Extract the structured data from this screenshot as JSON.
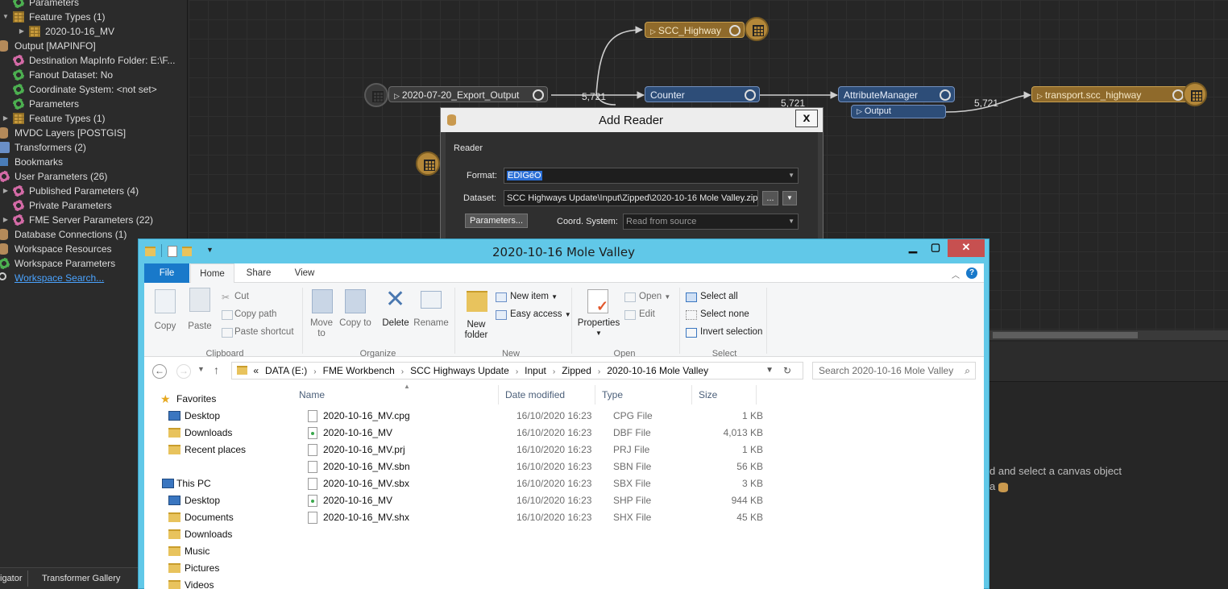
{
  "navigator": {
    "rows": [
      {
        "label": "Parameters",
        "icon": "gear-icon",
        "indent": 1
      },
      {
        "label": "Feature Types (1)",
        "icon": "table-icon",
        "indent": 1,
        "expanded": true
      },
      {
        "label": "2020-10-16_MV",
        "icon": "table-icon",
        "indent": 2
      },
      {
        "label": "Output [MAPINFO]",
        "icon": "database-icon",
        "indent": 0
      },
      {
        "label": "Destination MapInfo Folder: E:\\F...",
        "icon": "parameter-icon",
        "indent": 1
      },
      {
        "label": "Fanout Dataset: No",
        "icon": "gear-icon",
        "indent": 1
      },
      {
        "label": "Coordinate System: <not set>",
        "icon": "gear-icon",
        "indent": 1
      },
      {
        "label": "Parameters",
        "icon": "gear-icon",
        "indent": 1
      },
      {
        "label": "Feature Types (1)",
        "icon": "table-icon",
        "indent": 1
      },
      {
        "label": "MVDC Layers [POSTGIS]",
        "icon": "database-icon",
        "indent": 0
      },
      {
        "label": "Transformers (2)",
        "icon": "transformer-icon",
        "indent": 0
      },
      {
        "label": "Bookmarks",
        "icon": "bookmark-icon",
        "indent": 0
      },
      {
        "label": "User Parameters (26)",
        "icon": "parameter-icon",
        "indent": 0
      },
      {
        "label": "Published Parameters (4)",
        "icon": "parameter-icon",
        "indent": 1
      },
      {
        "label": "Private Parameters",
        "icon": "parameter-icon",
        "indent": 1
      },
      {
        "label": "FME Server Parameters (22)",
        "icon": "parameter-icon",
        "indent": 1
      },
      {
        "label": "Database Connections (1)",
        "icon": "database-icon",
        "indent": 0
      },
      {
        "label": "Workspace Resources",
        "icon": "database-icon",
        "indent": 0
      },
      {
        "label": "Workspace Parameters",
        "icon": "gear-icon",
        "indent": 0
      },
      {
        "label": "Workspace Search...",
        "icon": "search-icon",
        "indent": 0,
        "link": true
      }
    ],
    "tabs": [
      "igator",
      "Transformer Gallery"
    ]
  },
  "canvas": {
    "nodes": {
      "scc_highway": "SCC_Highway",
      "reader": "2020-07-20_Export_Output",
      "counter": "Counter",
      "attribute_manager": "AttributeManager",
      "output_port": "Output",
      "writer": "transport.scc_highway"
    },
    "counts": [
      "5,721",
      "5,721",
      "5,721"
    ]
  },
  "right_panel": {
    "hint_line1": "d and select a canvas object",
    "hint_line2": "a"
  },
  "add_reader": {
    "title": "Add Reader",
    "group_label": "Reader",
    "format_label": "Format:",
    "format_value": "EDIGéO",
    "dataset_label": "Dataset:",
    "dataset_value": "SCC Highways Update\\Input\\Zipped\\2020-10-16 Mole Valley.zip\"",
    "browse_label": "...",
    "parameters_label": "Parameters...",
    "coord_label": "Coord. System:",
    "coord_value": "Read from source",
    "close_label": "x"
  },
  "explorer": {
    "title": "2020-10-16 Mole Valley",
    "ribbon_tabs": [
      "File",
      "Home",
      "Share",
      "View"
    ],
    "ribbon": {
      "clipboard": {
        "group": "Clipboard",
        "copy": "Copy",
        "paste": "Paste",
        "cut": "Cut",
        "copy_path": "Copy path",
        "paste_shortcut": "Paste shortcut"
      },
      "organize": {
        "group": "Organize",
        "move_to": "Move to",
        "copy_to": "Copy to",
        "delete": "Delete",
        "rename": "Rename"
      },
      "new": {
        "group": "New",
        "new_folder": "New folder",
        "new_item": "New item",
        "easy_access": "Easy access"
      },
      "open": {
        "group": "Open",
        "properties": "Properties",
        "open": "Open",
        "edit": "Edit"
      },
      "select": {
        "group": "Select",
        "select_all": "Select all",
        "select_none": "Select none",
        "invert_selection": "Invert selection"
      }
    },
    "address": [
      "«",
      "DATA (E:)",
      "FME Workbench",
      "SCC Highways Update",
      "Input",
      "Zipped",
      "2020-10-16 Mole Valley"
    ],
    "search_placeholder": "Search 2020-10-16 Mole Valley",
    "tree": {
      "favorites": "Favorites",
      "fav_items": [
        "Desktop",
        "Downloads",
        "Recent places"
      ],
      "this_pc": "This PC",
      "pc_items": [
        "Desktop",
        "Documents",
        "Downloads",
        "Music",
        "Pictures",
        "Videos"
      ]
    },
    "columns": [
      "Name",
      "Date modified",
      "Type",
      "Size"
    ],
    "files": [
      {
        "name": "2020-10-16_MV.cpg",
        "date": "16/10/2020 16:23",
        "type": "CPG File",
        "size": "1 KB",
        "icon": "file-icon"
      },
      {
        "name": "2020-10-16_MV",
        "date": "16/10/2020 16:23",
        "type": "DBF File",
        "size": "4,013 KB",
        "icon": "dbf-file-icon"
      },
      {
        "name": "2020-10-16_MV.prj",
        "date": "16/10/2020 16:23",
        "type": "PRJ File",
        "size": "1 KB",
        "icon": "file-icon"
      },
      {
        "name": "2020-10-16_MV.sbn",
        "date": "16/10/2020 16:23",
        "type": "SBN File",
        "size": "56 KB",
        "icon": "file-icon"
      },
      {
        "name": "2020-10-16_MV.sbx",
        "date": "16/10/2020 16:23",
        "type": "SBX File",
        "size": "3 KB",
        "icon": "file-icon"
      },
      {
        "name": "2020-10-16_MV",
        "date": "16/10/2020 16:23",
        "type": "SHP File",
        "size": "944 KB",
        "icon": "shp-file-icon"
      },
      {
        "name": "2020-10-16_MV.shx",
        "date": "16/10/2020 16:23",
        "type": "SHX File",
        "size": "45 KB",
        "icon": "file-icon"
      }
    ]
  },
  "colors": {
    "canvas_bg": "#262626",
    "writer_node": "#8f6a2b",
    "transformer_node": "#2d4d78",
    "explorer_frame": "#61c8e8",
    "file_tab": "#1979ca",
    "selection": "#2b6fd6",
    "close_button": "#c75050"
  }
}
